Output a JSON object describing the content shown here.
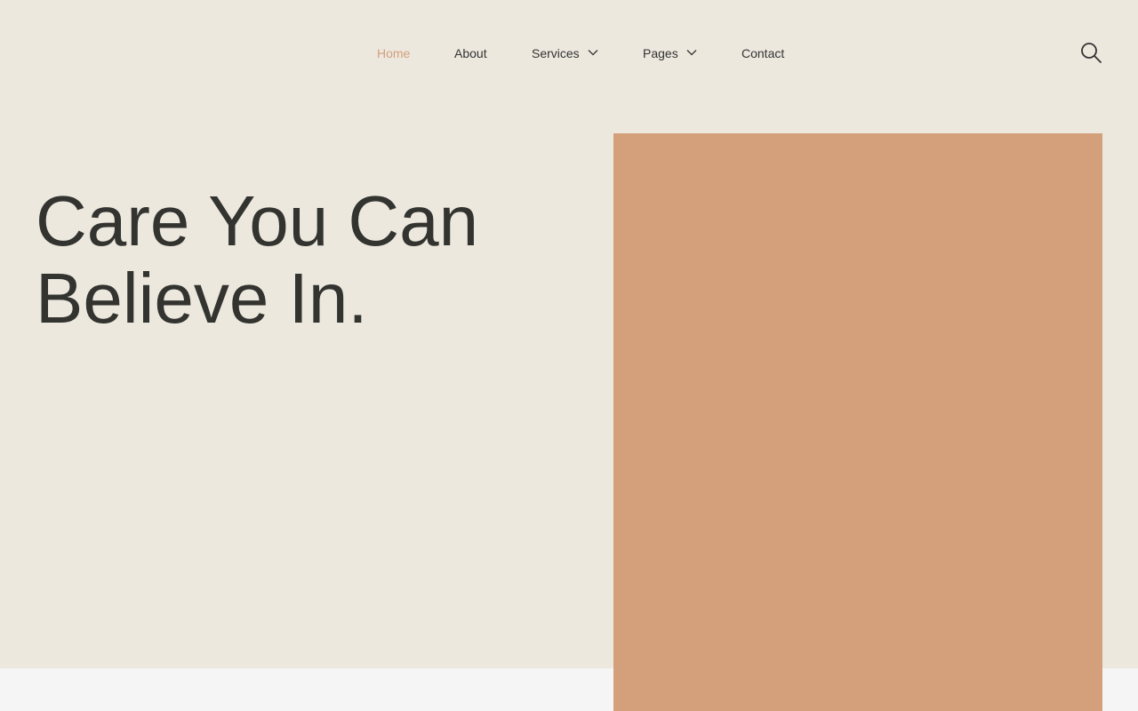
{
  "nav": {
    "items": [
      {
        "label": "Home",
        "active": true,
        "dropdown": false
      },
      {
        "label": "About",
        "active": false,
        "dropdown": false
      },
      {
        "label": "Services",
        "active": false,
        "dropdown": true
      },
      {
        "label": "Pages",
        "active": false,
        "dropdown": true
      },
      {
        "label": "Contact",
        "active": false,
        "dropdown": false
      }
    ],
    "search_icon": "search-icon"
  },
  "hero": {
    "title_line1": "Care You Can",
    "title_line2": "Believe In."
  },
  "colors": {
    "background": "#ece8de",
    "accent": "#d39f7d",
    "image_block": "#d4a07c",
    "text": "#333330"
  }
}
